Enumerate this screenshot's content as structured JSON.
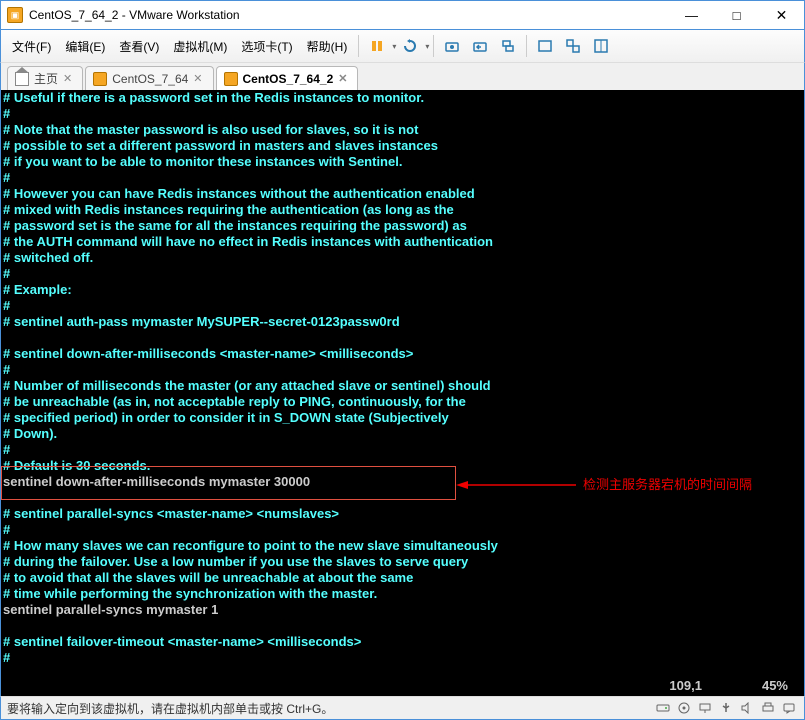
{
  "window": {
    "title": "CentOS_7_64_2 - VMware Workstation",
    "minimize": "—",
    "maximize": "□",
    "close": "✕"
  },
  "menu": {
    "file": "文件(F)",
    "edit": "编辑(E)",
    "view": "查看(V)",
    "vm": "虚拟机(M)",
    "tabs": "选项卡(T)",
    "help": "帮助(H)"
  },
  "tabs": {
    "home": "主页",
    "t1": "CentOS_7_64",
    "t2": "CentOS_7_64_2"
  },
  "terminal": {
    "lines": [
      {
        "c": "c",
        "t": "# Useful if there is a password set in the Redis instances to monitor."
      },
      {
        "c": "c",
        "t": "#"
      },
      {
        "c": "c",
        "t": "# Note that the master password is also used for slaves, so it is not"
      },
      {
        "c": "c",
        "t": "# possible to set a different password in masters and slaves instances"
      },
      {
        "c": "c",
        "t": "# if you want to be able to monitor these instances with Sentinel."
      },
      {
        "c": "c",
        "t": "#"
      },
      {
        "c": "c",
        "t": "# However you can have Redis instances without the authentication enabled"
      },
      {
        "c": "c",
        "t": "# mixed with Redis instances requiring the authentication (as long as the"
      },
      {
        "c": "c",
        "t": "# password set is the same for all the instances requiring the password) as"
      },
      {
        "c": "c",
        "t": "# the AUTH command will have no effect in Redis instances with authentication"
      },
      {
        "c": "c",
        "t": "# switched off."
      },
      {
        "c": "c",
        "t": "#"
      },
      {
        "c": "c",
        "t": "# Example:"
      },
      {
        "c": "c",
        "t": "#"
      },
      {
        "c": "c",
        "t": "# sentinel auth-pass mymaster MySUPER--secret-0123passw0rd"
      },
      {
        "c": "c",
        "t": ""
      },
      {
        "c": "c",
        "t": "# sentinel down-after-milliseconds <master-name> <milliseconds>"
      },
      {
        "c": "c",
        "t": "#"
      },
      {
        "c": "c",
        "t": "# Number of milliseconds the master (or any attached slave or sentinel) should"
      },
      {
        "c": "c",
        "t": "# be unreachable (as in, not acceptable reply to PING, continuously, for the"
      },
      {
        "c": "c",
        "t": "# specified period) in order to consider it in S_DOWN state (Subjectively"
      },
      {
        "c": "c",
        "t": "# Down)."
      },
      {
        "c": "c",
        "t": "#"
      },
      {
        "c": "c",
        "t": "# Default is 30 seconds."
      },
      {
        "c": "w",
        "t": "sentinel down-after-milliseconds mymaster 30000"
      },
      {
        "c": "c",
        "t": ""
      },
      {
        "c": "c",
        "t": "# sentinel parallel-syncs <master-name> <numslaves>"
      },
      {
        "c": "c",
        "t": "#"
      },
      {
        "c": "c",
        "t": "# How many slaves we can reconfigure to point to the new slave simultaneously"
      },
      {
        "c": "c",
        "t": "# during the failover. Use a low number if you use the slaves to serve query"
      },
      {
        "c": "c",
        "t": "# to avoid that all the slaves will be unreachable at about the same"
      },
      {
        "c": "c",
        "t": "# time while performing the synchronization with the master."
      },
      {
        "c": "w",
        "t": "sentinel parallel-syncs mymaster 1"
      },
      {
        "c": "c",
        "t": ""
      },
      {
        "c": "c",
        "t": "# sentinel failover-timeout <master-name> <milliseconds>"
      },
      {
        "c": "c",
        "t": "#"
      },
      {
        "c": "c",
        "t": ""
      }
    ],
    "pos": "109,1",
    "pct": "45%"
  },
  "annotation": {
    "text": "检测主服务器宕机的时间间隔"
  },
  "status": {
    "text": "要将输入定向到该虚拟机，请在虚拟机内部单击或按 Ctrl+G。"
  }
}
